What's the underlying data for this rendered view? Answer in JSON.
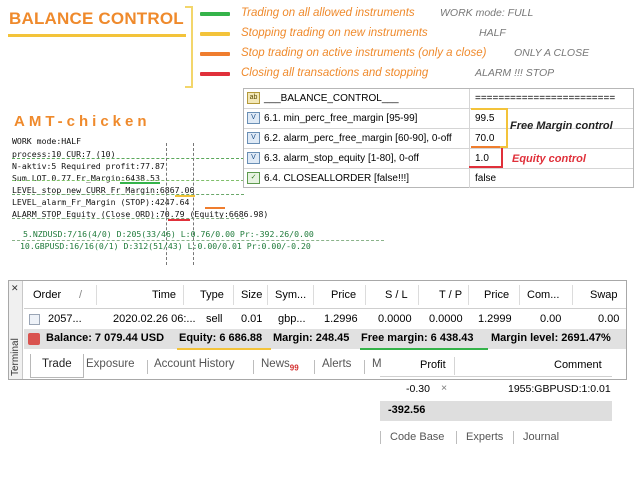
{
  "legend": {
    "title": "BALANCE CONTROL",
    "modes": [
      {
        "bar_color": "#35b34a",
        "text": "Trading on all allowed instruments",
        "tag": "WORK mode: FULL"
      },
      {
        "bar_color": "#f3c33a",
        "text": "Stopping trading  on new instruments",
        "tag": "HALF"
      },
      {
        "bar_color": "#ef7d2e",
        "text": "Stop trading on active instruments (only a close)",
        "tag": "ONLY A CLOSE"
      },
      {
        "bar_color": "#e0303a",
        "text": "Closing all transactions and stopping",
        "tag": "ALARM !!!  STOP"
      }
    ]
  },
  "chart": {
    "title": "AMT-chicken",
    "lines": [
      "WORK mode:HALF",
      "process:10  CUR:7 (10)",
      "N-aktiv:5  Required profit:77.87",
      "Sum LOT 0.77  Fr_Margin:6438.53",
      "LEVEL_stop_new_CURR_Fr_Margin:6867.06",
      "LEVEL_alarm_Fr_Margin  (STOP):4247.64",
      "ALARM_STOP_Equity (Close ORD):70.79  (Equity:6686.98)"
    ],
    "symbol_rows": [
      {
        "text": "5.NZDUSD:7/16(4/0) D:205(33/46) L:0.76/0.00 Pr:-392.26/0.00",
        "color": "#1f7a3a"
      },
      {
        "text": "10.GBPUSD:16/16(0/1) D:312(51/43) L:0.00/0.01 Pr:0.00/-0.20",
        "color": "#1f7a3a"
      }
    ]
  },
  "properties": {
    "header": {
      "icon": "ab",
      "name": "___BALANCE_CONTROL___",
      "value": "========================"
    },
    "rows": [
      {
        "icon": "param-icon",
        "name": "6.1. min_perc_free_margin [95-99]",
        "value": "99.5"
      },
      {
        "icon": "param-icon",
        "name": "6.2. alarm_perc_free_margin [60-90], 0-off",
        "value": "70.0"
      },
      {
        "icon": "param-icon",
        "name": "6.3. alarm_stop_equity [1-80], 0-off",
        "value": "1.0"
      },
      {
        "icon": "bool-icon",
        "name": "6.4. CLOSEALLORDER [false!!!]",
        "value": "false"
      }
    ],
    "annotations": {
      "free_margin": "Free Margin control",
      "equity": "Equity control"
    }
  },
  "terminal": {
    "label": "Terminal",
    "columns": [
      "Order",
      "/",
      "Time",
      "Type",
      "Size",
      "Sym...",
      "Price",
      "S / L",
      "T / P",
      "Price",
      "Com...",
      "Swap"
    ],
    "order_row": [
      "2057...",
      "2020.02.26 06:...",
      "sell",
      "0.01",
      "gbp...",
      "1.2996",
      "0.0000",
      "0.0000",
      "1.2999",
      "0.00",
      "0.00"
    ],
    "balance": {
      "balance": "Balance: 7 079.44 USD",
      "equity": "Equity: 6 686.88",
      "margin": "Margin: 248.45",
      "free_margin": "Free margin: 6 438.43",
      "margin_level": "Margin level: 2691.47%"
    },
    "tabs": [
      "Trade",
      "Exposure",
      "Account History",
      "News",
      "Alerts",
      "M"
    ],
    "news_badge": "99"
  },
  "fragment": {
    "columns": [
      "Profit",
      "Comment"
    ],
    "row": {
      "profit": "-0.30",
      "close": "×",
      "comment": "1955:GBPUSD:1:0.01"
    },
    "total": "-392.56",
    "tabs": [
      "Code Base",
      "Experts",
      "Journal"
    ]
  }
}
